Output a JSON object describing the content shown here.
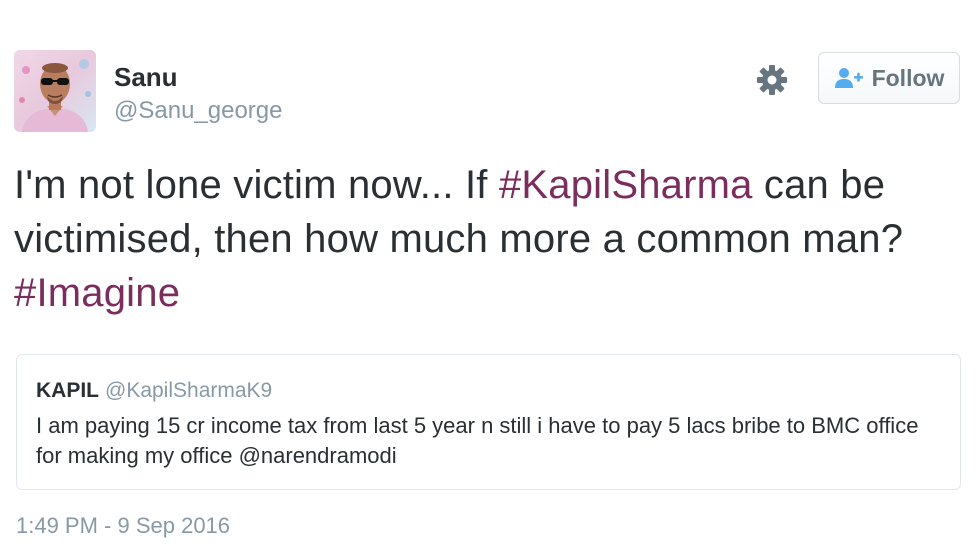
{
  "author": {
    "name": "Sanu",
    "handle": "@Sanu_george"
  },
  "actions": {
    "settings_icon": "gear-icon",
    "follow_icon": "follow-user-icon",
    "follow_label": "Follow"
  },
  "tweet": {
    "segments": [
      "I'm not lone victim now... If ",
      "#KapilSharma",
      " can be victimised, then how much more a common man? ",
      "#Imagine"
    ],
    "hashtag_color": "#7b2d5e",
    "timestamp": "1:49 PM - 9 Sep 2016"
  },
  "quoted": {
    "name": "KAPIL",
    "handle": "@KapilSharmaK9",
    "text_segments": [
      "I am paying 15 cr income tax from last 5 year n still i have to pay 5 lacs bribe to BMC office for making my office ",
      "@narendramodi"
    ]
  },
  "colors": {
    "text": "#292f33",
    "muted": "#8899a6",
    "border": "#e1e8ed"
  }
}
